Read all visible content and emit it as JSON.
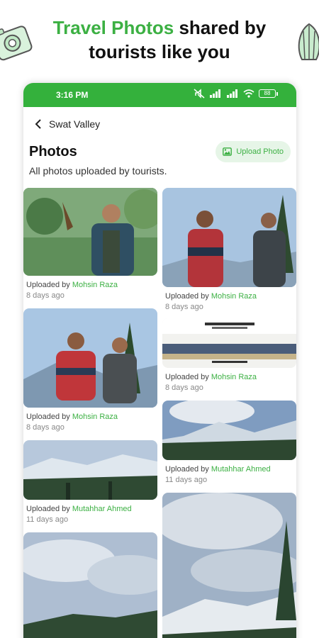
{
  "promo": {
    "title_accent": "Travel Photos",
    "title_rest": " shared by",
    "title_line2": "tourists like you"
  },
  "status": {
    "time": "3:16 PM",
    "battery": "88"
  },
  "appbar": {
    "title": "Swat Valley"
  },
  "page": {
    "title": "Photos",
    "subtitle": "All photos uploaded by tourists.",
    "upload_label": "Upload Photo"
  },
  "photos": [
    {
      "uploaded_prefix": "Uploaded by ",
      "uploader": "Mohsin Raza",
      "ago": "8 days ago"
    },
    {
      "uploaded_prefix": "Uploaded by ",
      "uploader": "Mohsin Raza",
      "ago": "8 days ago"
    },
    {
      "uploaded_prefix": "Uploaded by ",
      "uploader": "Mohsin Raza",
      "ago": "8 days ago"
    },
    {
      "uploaded_prefix": "Uploaded by ",
      "uploader": "Mohsin Raza",
      "ago": "8 days ago"
    },
    {
      "uploaded_prefix": "Uploaded by ",
      "uploader": "Mutahhar Ahmed",
      "ago": "11 days ago"
    },
    {
      "uploaded_prefix": "Uploaded by ",
      "uploader": "Mutahhar Ahmed",
      "ago": "11 days ago"
    }
  ],
  "colors": {
    "accent": "#3cb043",
    "statusbar": "#34b13c",
    "button_bg": "#e6f5e7"
  }
}
